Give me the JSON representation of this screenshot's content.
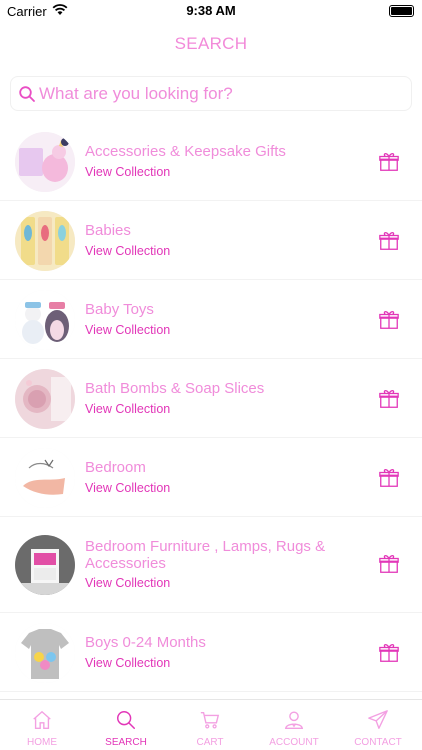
{
  "status_bar": {
    "carrier": "Carrier",
    "time": "9:38 AM"
  },
  "header": {
    "title": "SEARCH"
  },
  "search": {
    "placeholder": "What are you looking for?"
  },
  "collections": [
    {
      "title": "Accessories & Keepsake Gifts",
      "link": "View Collection",
      "image": "unicorn-plush-image"
    },
    {
      "title": "Babies",
      "link": "View Collection",
      "image": "baby-brushes-image"
    },
    {
      "title": "Baby Toys",
      "link": "View Collection",
      "image": "snowman-penguin-toys-image"
    },
    {
      "title": "Bath Bombs & Soap Slices",
      "link": "View Collection",
      "image": "bath-bombs-image"
    },
    {
      "title": "Bedroom",
      "link": "View Collection",
      "image": "bedroom-logo-image"
    },
    {
      "title": "Bedroom Furniture , Lamps, Rugs & Accessories",
      "link": "View Collection",
      "image": "bedside-cabinet-image"
    },
    {
      "title": "Boys 0-24 Months",
      "link": "View Collection",
      "image": "baby-shark-tshirt-image"
    }
  ],
  "tabs": [
    {
      "label": "HOME",
      "icon": "home-icon",
      "active": false
    },
    {
      "label": "SEARCH",
      "icon": "search-icon",
      "active": true
    },
    {
      "label": "CART",
      "icon": "cart-icon",
      "active": false
    },
    {
      "label": "ACCOUNT",
      "icon": "account-icon",
      "active": false
    },
    {
      "label": "CONTACT",
      "icon": "paper-plane-icon",
      "active": false
    }
  ],
  "colors": {
    "accent": "#e236b8",
    "accent_light": "#f08cda",
    "divider": "#f2f2f2"
  }
}
